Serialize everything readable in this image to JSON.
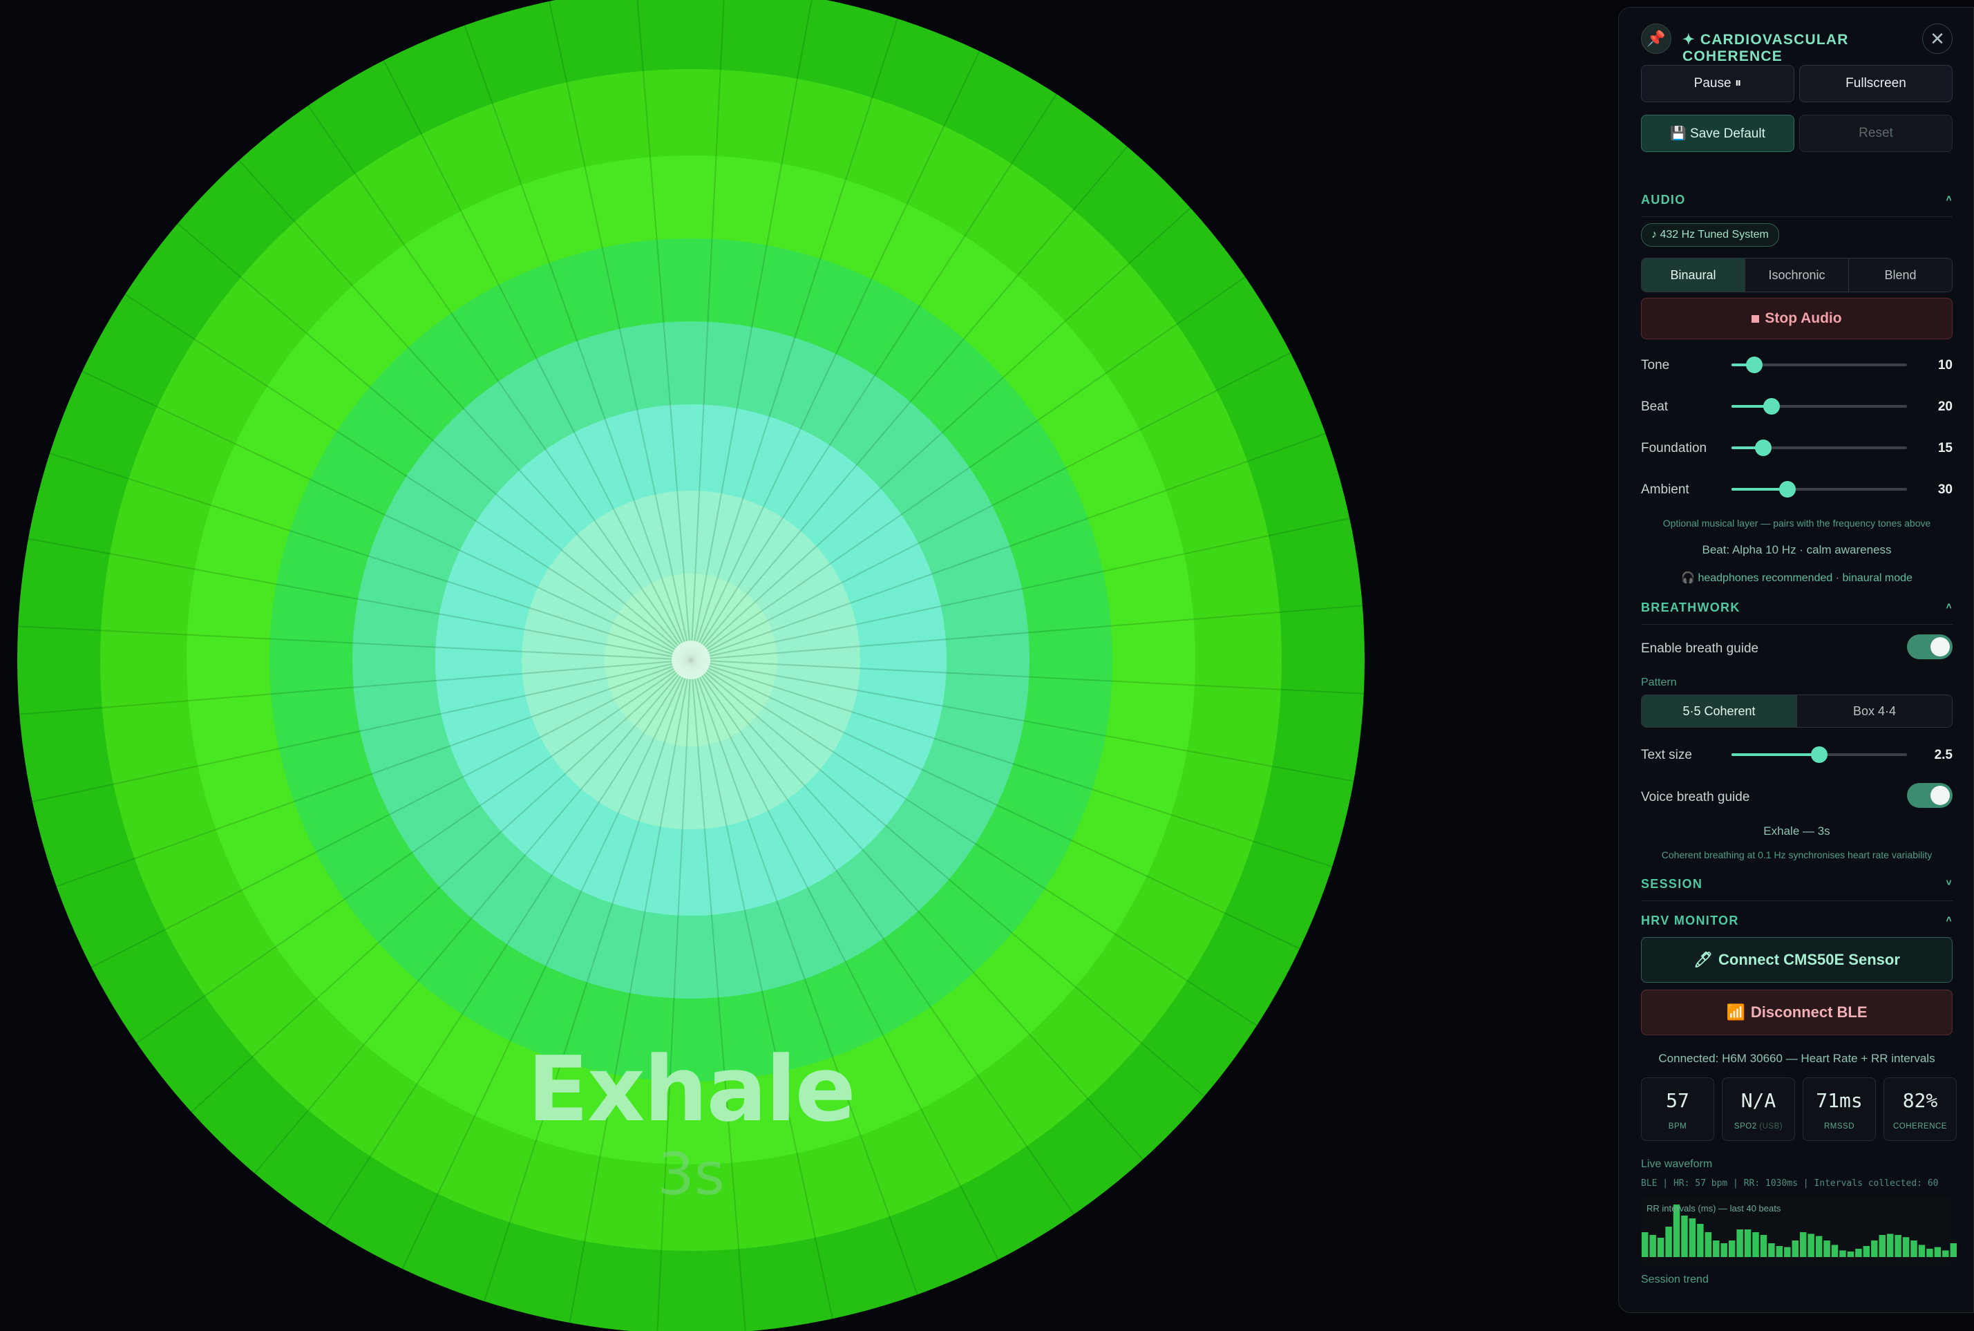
{
  "visual": {
    "phase_word": "Exhale",
    "phase_seconds": "3s",
    "rings": [
      "#a7f5c8",
      "#97f2cd",
      "#74eed0",
      "#52e59a",
      "#35e04a",
      "#49e622",
      "#3ed817",
      "#24c113"
    ]
  },
  "panel": {
    "title": "✦ CARDIOVASCULAR COHERENCE",
    "pin_icon": "📌",
    "close_icon": "✕",
    "pause_label": "Pause ⏸",
    "fullscreen_label": "Fullscreen",
    "save_label": "💾 Save Default",
    "reset_label": "Reset"
  },
  "audio": {
    "header": "AUDIO",
    "tuning_chip": "♪ 432 Hz Tuned System",
    "modes": [
      "Binaural",
      "Isochronic",
      "Blend"
    ],
    "active_mode": 0,
    "stop_label": "Stop Audio",
    "sliders": [
      {
        "label": "Tone",
        "value": 10,
        "fraction": 0.13
      },
      {
        "label": "Beat",
        "value": 20,
        "fraction": 0.23
      },
      {
        "label": "Foundation",
        "value": 15,
        "fraction": 0.18
      },
      {
        "label": "Ambient",
        "value": 30,
        "fraction": 0.32
      }
    ],
    "note_music": "Optional musical layer — pairs with the frequency tones above",
    "note_beat": "Beat: Alpha 10 Hz · calm awareness",
    "note_headphones": "🎧 headphones recommended · binaural mode"
  },
  "breathwork": {
    "header": "BREATHWORK",
    "enable_label": "Enable breath guide",
    "enable_on": true,
    "pattern_label": "Pattern",
    "patterns": [
      "5·5 Coherent",
      "Box 4·4"
    ],
    "active_pattern": 0,
    "text_size_label": "Text size",
    "text_size_value": "2.5",
    "text_size_fraction": 0.5,
    "voice_label": "Voice breath guide",
    "voice_on": true,
    "phase_status": "Exhale — 3s",
    "note": "Coherent breathing at 0.1 Hz synchronises heart rate variability"
  },
  "session": {
    "header": "SESSION"
  },
  "hrv": {
    "header": "HRV MONITOR",
    "connect_label": "Connect CMS50E Sensor",
    "disconnect_label": "Disconnect BLE",
    "status": "Connected: H6M 30660 — Heart Rate + RR intervals",
    "stats": [
      {
        "value": "57",
        "label": "BPM",
        "sub": ""
      },
      {
        "value": "N/A",
        "label": "SPO2",
        "sub": " (USB)"
      },
      {
        "value": "71ms",
        "label": "RMSSD",
        "sub": ""
      },
      {
        "value": "82%",
        "label": "COHERENCE",
        "sub": ""
      }
    ],
    "waveform_label": "Live waveform",
    "ble_line": "BLE | HR: 57 bpm | RR: 1030ms | Intervals collected: 60",
    "rr_caption": "RR intervals (ms) — last 40 beats",
    "rr_bars": [
      0.45,
      0.4,
      0.35,
      0.55,
      0.95,
      0.75,
      0.7,
      0.6,
      0.45,
      0.3,
      0.25,
      0.3,
      0.5,
      0.5,
      0.45,
      0.4,
      0.25,
      0.2,
      0.18,
      0.3,
      0.45,
      0.42,
      0.38,
      0.3,
      0.22,
      0.12,
      0.1,
      0.15,
      0.2,
      0.3,
      0.4,
      0.42,
      0.4,
      0.36,
      0.3,
      0.22,
      0.15,
      0.18,
      0.12,
      0.25
    ],
    "trend_label": "Session trend"
  }
}
